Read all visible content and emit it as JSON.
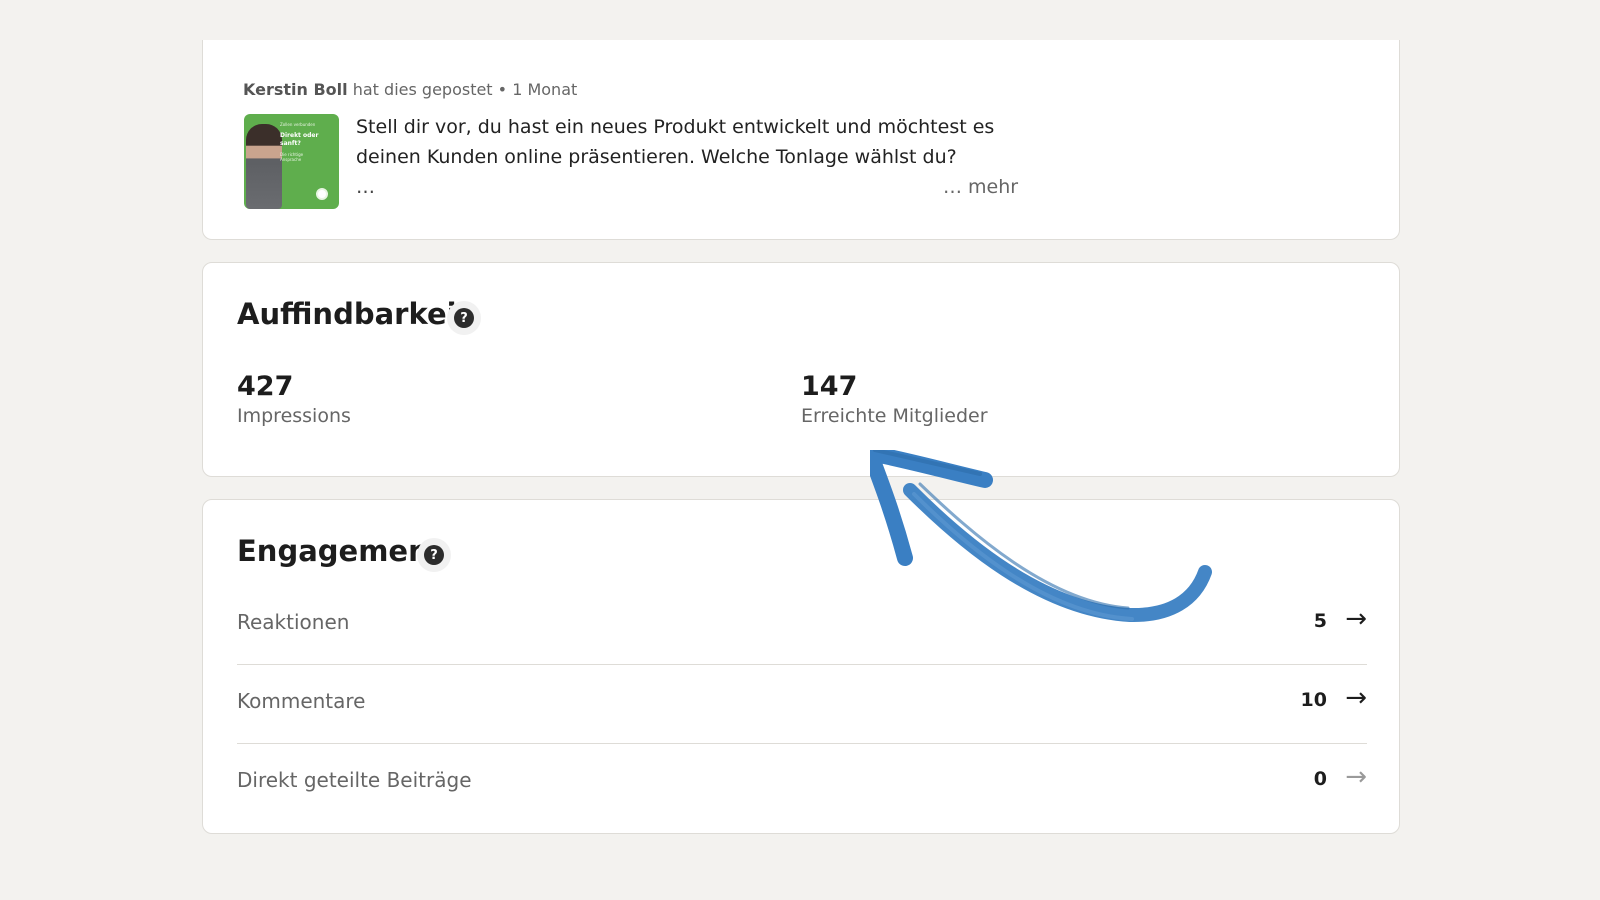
{
  "post": {
    "author": "Kerstin Boll",
    "meta": "hat dies gepostet • 1 Monat",
    "text": "Stell dir vor, du hast ein neues Produkt entwickelt und möchtest es deinen Kunden online präsentieren. Welche Tonlage wählst du?",
    "ellipsis": "…",
    "more": "… mehr",
    "thumbnail": {
      "small": "Zollen verbunden",
      "title": "Direkt oder sanft?",
      "sub": "Die richtige Ansprache"
    }
  },
  "discoverability": {
    "title": "Auffindbarkeit",
    "stats": [
      {
        "value": "427",
        "label": "Impressions"
      },
      {
        "value": "147",
        "label": "Erreichte Mitglieder"
      }
    ]
  },
  "engagement": {
    "title": "Engagement",
    "rows": [
      {
        "label": "Reaktionen",
        "value": "5",
        "arrow": "→"
      },
      {
        "label": "Kommentare",
        "value": "10",
        "arrow": "→"
      },
      {
        "label": "Direkt geteilte Beiträge",
        "value": "0",
        "arrow": "→"
      }
    ]
  },
  "icons": {
    "help": "?"
  },
  "colors": {
    "background": "#f3f2ef",
    "card": "#ffffff",
    "annotation_arrow": "#3a7fc3",
    "thumbnail_green": "#5fae4d"
  }
}
